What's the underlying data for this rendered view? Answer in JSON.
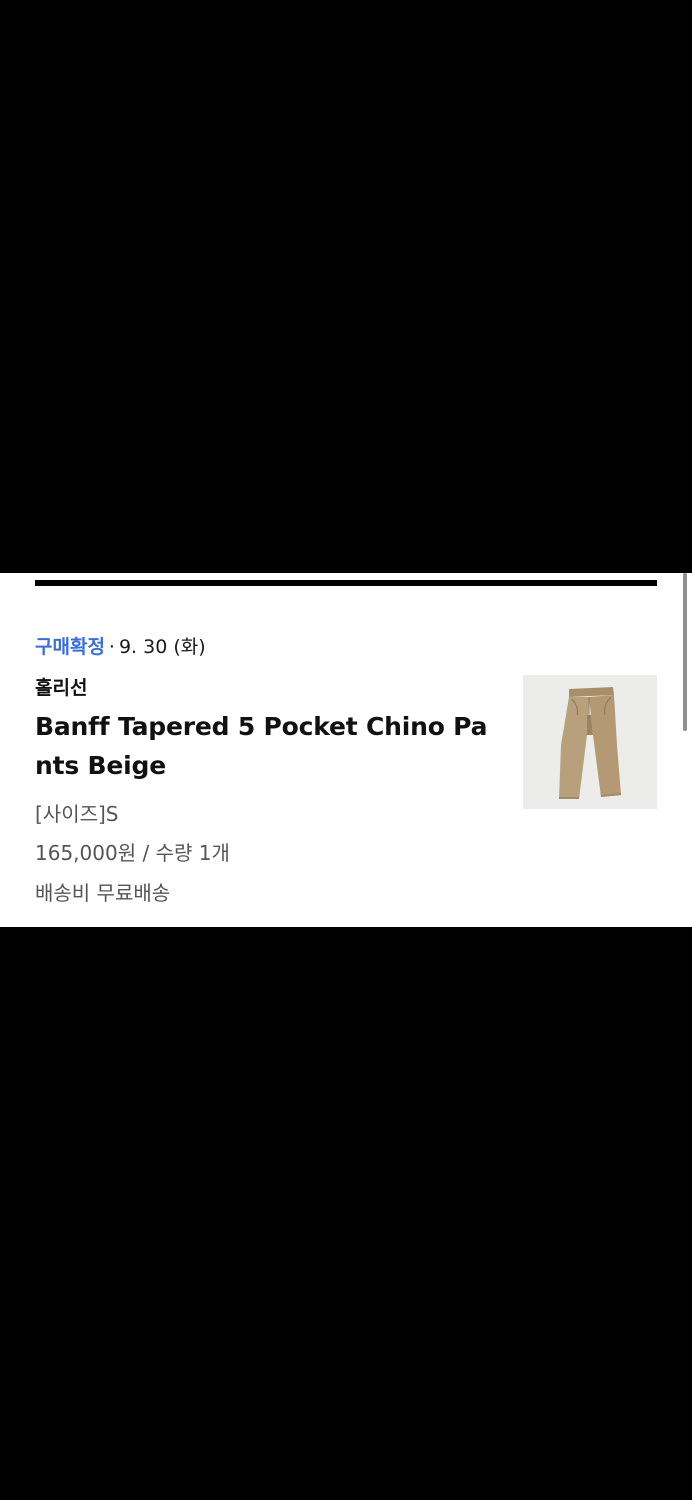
{
  "order": {
    "status": "구매확정",
    "separator": "·",
    "date": "9. 30 (화)",
    "brand": "홀리선",
    "product_name": "Banff Tapered 5 Pocket Chino Pants Beige",
    "option": "[사이즈]S",
    "price_qty": "165,000원 / 수량 1개",
    "shipping": "배송비 무료배송",
    "thumbnail_icon": "beige-chino-pants-image"
  },
  "colors": {
    "status": "#3b6ddd",
    "background": "#000000",
    "card": "#ffffff",
    "pants": "#b8a07c"
  }
}
